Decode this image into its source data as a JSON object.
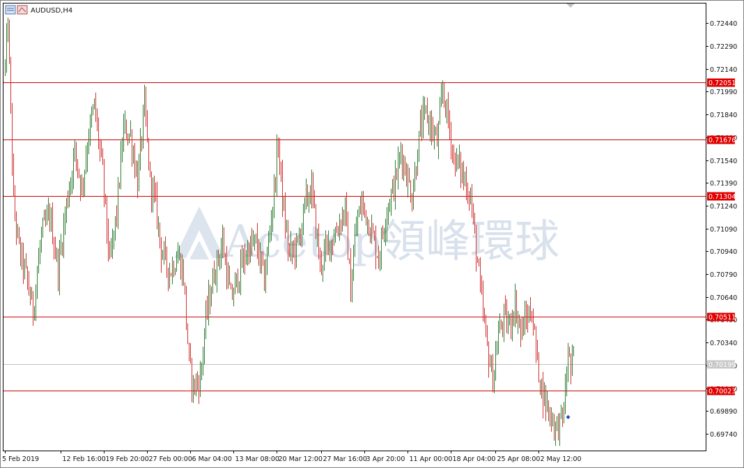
{
  "window": {
    "symbol_title": "AUDUSD,H4"
  },
  "colors": {
    "bull": "#2e7d32",
    "bear": "#d32f2f",
    "level_line": "#cc0000",
    "level_label_bg": "#e00000",
    "bid_line": "#c0c0c0",
    "bid_label_bg": "#c8c8c8",
    "grid_frame": "#000000",
    "watermark": "#2c5c9c"
  },
  "watermark": {
    "text": "Acetop領峰環球",
    "icon": "acetop-a-logo-icon"
  },
  "chart_data": {
    "type": "candlestick",
    "symbol": "AUDUSD",
    "timeframe": "H4",
    "ylim": [
      0.6963,
      0.7257
    ],
    "y_ticks": [
      "0.72440",
      "0.72290",
      "0.72140",
      "0.71990",
      "0.71840",
      "0.71690",
      "0.71540",
      "0.71390",
      "0.71240",
      "0.71090",
      "0.70940",
      "0.70790",
      "0.70640",
      "0.70490",
      "0.70340",
      "0.70190",
      "0.70040",
      "0.69890",
      "0.69740"
    ],
    "x_ticks": [
      {
        "label": "5 Feb 2019",
        "i": 0
      },
      {
        "label": "12 Feb 16:00",
        "i": 40
      },
      {
        "label": "19 Feb 20:00",
        "i": 71
      },
      {
        "label": "27 Feb 00:00",
        "i": 102
      },
      {
        "label": "6 Mar 04:00",
        "i": 133
      },
      {
        "label": "13 Mar 08:00",
        "i": 164
      },
      {
        "label": "20 Mar 12:00",
        "i": 195
      },
      {
        "label": "27 Mar 16:00",
        "i": 227
      },
      {
        "label": "3 Apr 20:00",
        "i": 258
      },
      {
        "label": "11 Apr 00:00",
        "i": 289
      },
      {
        "label": "18 Apr 04:00",
        "i": 320
      },
      {
        "label": "25 Apr 08:00",
        "i": 352
      },
      {
        "label": "2 May 12:00",
        "i": 383
      }
    ],
    "horizontal_levels": [
      {
        "value": 0.72051,
        "label": "0.72051"
      },
      {
        "value": 0.71676,
        "label": "0.71676"
      },
      {
        "value": 0.71304,
        "label": "0.71304"
      },
      {
        "value": 0.70511,
        "label": "0.70511"
      },
      {
        "value": 0.70023,
        "label": "0.70023"
      }
    ],
    "bid": {
      "value": 0.70199,
      "label": "0.70199"
    },
    "current_marker": {
      "value": 0.6985,
      "icon": "current-price-marker-icon"
    },
    "path_anchors": [
      [
        0,
        0.7215
      ],
      [
        2,
        0.7245
      ],
      [
        6,
        0.7125
      ],
      [
        10,
        0.7095
      ],
      [
        15,
        0.7078
      ],
      [
        20,
        0.7055
      ],
      [
        26,
        0.7105
      ],
      [
        32,
        0.7118
      ],
      [
        38,
        0.7082
      ],
      [
        44,
        0.7125
      ],
      [
        50,
        0.716
      ],
      [
        55,
        0.7135
      ],
      [
        60,
        0.7172
      ],
      [
        64,
        0.719
      ],
      [
        70,
        0.7145
      ],
      [
        75,
        0.7085
      ],
      [
        80,
        0.712
      ],
      [
        85,
        0.7175
      ],
      [
        90,
        0.717
      ],
      [
        95,
        0.714
      ],
      [
        100,
        0.719
      ],
      [
        104,
        0.714
      ],
      [
        108,
        0.7125
      ],
      [
        112,
        0.7095
      ],
      [
        118,
        0.708
      ],
      [
        124,
        0.7092
      ],
      [
        128,
        0.7078
      ],
      [
        132,
        0.702
      ],
      [
        135,
        0.7005
      ],
      [
        140,
        0.701
      ],
      [
        144,
        0.705
      ],
      [
        150,
        0.708
      ],
      [
        156,
        0.71
      ],
      [
        162,
        0.7062
      ],
      [
        168,
        0.708
      ],
      [
        174,
        0.7095
      ],
      [
        180,
        0.71
      ],
      [
        186,
        0.7075
      ],
      [
        192,
        0.7125
      ],
      [
        196,
        0.7165
      ],
      [
        200,
        0.7118
      ],
      [
        204,
        0.7092
      ],
      [
        210,
        0.7098
      ],
      [
        216,
        0.7128
      ],
      [
        220,
        0.7135
      ],
      [
        226,
        0.7085
      ],
      [
        232,
        0.7098
      ],
      [
        238,
        0.7108
      ],
      [
        244,
        0.7122
      ],
      [
        248,
        0.7068
      ],
      [
        252,
        0.7112
      ],
      [
        256,
        0.7126
      ],
      [
        262,
        0.711
      ],
      [
        268,
        0.709
      ],
      [
        274,
        0.7122
      ],
      [
        280,
        0.714
      ],
      [
        284,
        0.716
      ],
      [
        288,
        0.7145
      ],
      [
        292,
        0.713
      ],
      [
        298,
        0.7175
      ],
      [
        302,
        0.7185
      ],
      [
        306,
        0.7175
      ],
      [
        310,
        0.7165
      ],
      [
        314,
        0.72
      ],
      [
        318,
        0.718
      ],
      [
        322,
        0.7155
      ],
      [
        326,
        0.715
      ],
      [
        330,
        0.714
      ],
      [
        334,
        0.713
      ],
      [
        338,
        0.7095
      ],
      [
        342,
        0.706
      ],
      [
        346,
        0.703
      ],
      [
        350,
        0.701
      ],
      [
        354,
        0.704
      ],
      [
        358,
        0.705
      ],
      [
        362,
        0.7045
      ],
      [
        366,
        0.706
      ],
      [
        370,
        0.704
      ],
      [
        374,
        0.705
      ],
      [
        378,
        0.7055
      ],
      [
        382,
        0.702
      ],
      [
        386,
        0.7
      ],
      [
        390,
        0.699
      ],
      [
        394,
        0.698
      ],
      [
        396,
        0.6978
      ],
      [
        400,
        0.6985
      ],
      [
        402,
        0.7
      ],
      [
        404,
        0.703
      ],
      [
        406,
        0.7015
      ],
      [
        408,
        0.7025
      ]
    ]
  }
}
